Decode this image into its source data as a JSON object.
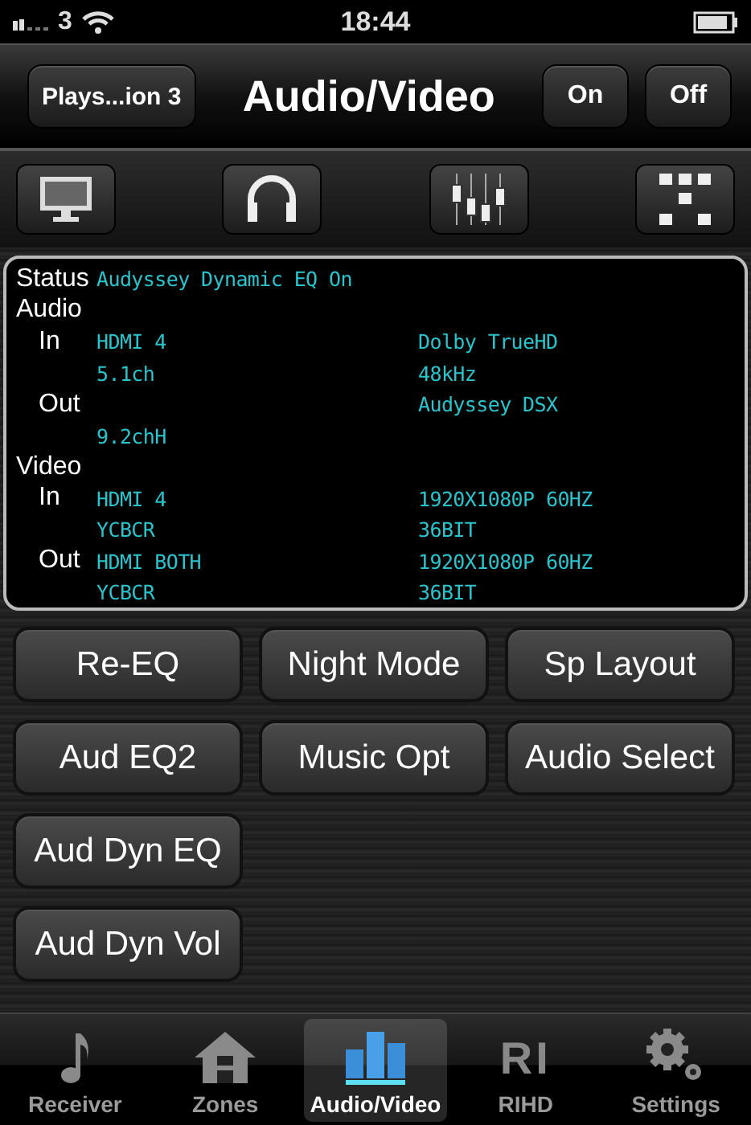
{
  "status_bar": {
    "carrier": "3",
    "time": "18:44"
  },
  "nav": {
    "back": "Plays...ion 3",
    "title": "Audio/Video",
    "buttons": [
      "On",
      "Off"
    ]
  },
  "toolbar": [
    {
      "kind": "monitor"
    },
    {
      "kind": "headphones"
    },
    {
      "kind": "equalizer"
    },
    {
      "kind": "grid"
    }
  ],
  "info": {
    "status_label": "Status",
    "status_value": "Audyssey Dynamic EQ On",
    "lines": [
      {
        "kind": "header",
        "label": "Audio"
      },
      {
        "kind": "row",
        "label": "In",
        "left": "HDMI 4",
        "right": "Dolby TrueHD"
      },
      {
        "kind": "row",
        "left": "5.1ch",
        "right": "48kHz"
      },
      {
        "kind": "row",
        "label": "Out",
        "right": "Audyssey DSX"
      },
      {
        "kind": "row",
        "left": "9.2chH"
      },
      {
        "kind": "header",
        "label": "Video"
      },
      {
        "kind": "row",
        "label": "In",
        "left": "HDMI 4",
        "right": "1920X1080P 60HZ"
      },
      {
        "kind": "row",
        "left": "YCBCR",
        "right": "36BIT"
      },
      {
        "kind": "row",
        "label": "Out",
        "left": "HDMI BOTH",
        "right": "1920X1080P 60HZ"
      },
      {
        "kind": "row",
        "left": "YCBCR",
        "right": "36BIT"
      }
    ]
  },
  "buttons": [
    [
      "Re-EQ",
      "Night Mode",
      "Sp Layout"
    ],
    [
      "Aud EQ2",
      "Music Opt",
      "Audio Select"
    ],
    [
      "Aud Dyn EQ"
    ],
    [
      "Aud Dyn Vol"
    ]
  ],
  "tabs": [
    {
      "kind": "note",
      "label": "Receiver",
      "selected": false
    },
    {
      "kind": "house",
      "label": "Zones",
      "selected": false
    },
    {
      "kind": "bars",
      "label": "Audio/Video",
      "selected": true
    },
    {
      "kind": "text",
      "icon_text": "RI",
      "label": "RIHD",
      "selected": false
    },
    {
      "kind": "gear",
      "label": "Settings",
      "selected": false
    }
  ]
}
